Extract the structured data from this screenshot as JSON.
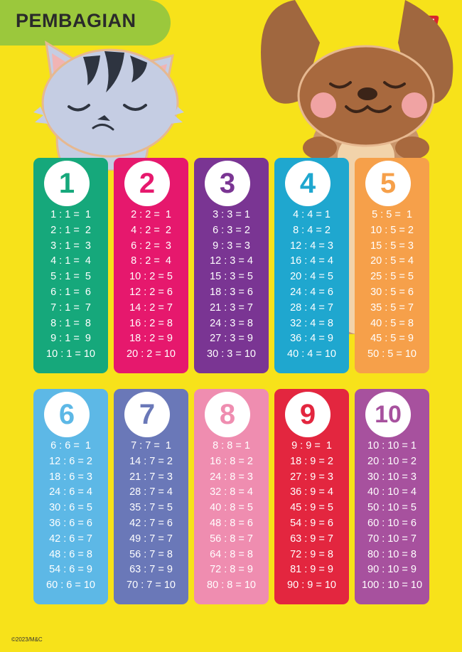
{
  "header": {
    "title": "PEMBAGIAN",
    "logo_text": "m&c!"
  },
  "footer": {
    "copyright": "©2023/M&C"
  },
  "colors": {
    "background": "#f7e21a",
    "title_badge": "#9bc83c",
    "logo": "#d8262e"
  },
  "illustrations": {
    "left": "cat-icon",
    "right": "dog-icon"
  },
  "cards": [
    {
      "divisor": "1",
      "color": "#16a87b",
      "rows": [
        "1 : 1 =  1",
        "2 : 1 =  2",
        "3 : 1 =  3",
        "4 : 1 =  4",
        "5 : 1 =  5",
        "6 : 1 =  6",
        "7 : 1 =  7",
        "8 : 1 =  8",
        "9 : 1 =  9",
        "10 : 1 = 10"
      ]
    },
    {
      "divisor": "2",
      "color": "#e6186d",
      "rows": [
        "2 : 2 =  1",
        "4 : 2 =  2",
        "6 : 2 =  3",
        "8 : 2 =  4",
        "10 : 2 = 5",
        "12 : 2 = 6",
        "14 : 2 = 7",
        "16 : 2 = 8",
        "18 : 2 = 9",
        "20 : 2 = 10"
      ]
    },
    {
      "divisor": "3",
      "color": "#7a3593",
      "rows": [
        "3 : 3 = 1",
        "6 : 3 = 2",
        "9 : 3 = 3",
        "12 : 3 = 4",
        "15 : 3 = 5",
        "18 : 3 = 6",
        "21 : 3 = 7",
        "24 : 3 = 8",
        "27 : 3 = 9",
        "30 : 3 = 10"
      ]
    },
    {
      "divisor": "4",
      "color": "#1fa7cf",
      "rows": [
        "4 : 4 = 1",
        "8 : 4 = 2",
        "12 : 4 = 3",
        "16 : 4 = 4",
        "20 : 4 = 5",
        "24 : 4 = 6",
        "28 : 4 = 7",
        "32 : 4 = 8",
        "36 : 4 = 9",
        "40 : 4 = 10"
      ]
    },
    {
      "divisor": "5",
      "color": "#f6a04a",
      "rows": [
        "5 : 5 =  1",
        "10 : 5 = 2",
        "15 : 5 = 3",
        "20 : 5 = 4",
        "25 : 5 = 5",
        "30 : 5 = 6",
        "35 : 5 = 7",
        "40 : 5 = 8",
        "45 : 5 = 9",
        "50 : 5 = 10"
      ]
    },
    {
      "divisor": "6",
      "color": "#5db8e6",
      "rows": [
        "6 : 6 =  1",
        "12 : 6 = 2",
        "18 : 6 = 3",
        "24 : 6 = 4",
        "30 : 6 = 5",
        "36 : 6 = 6",
        "42 : 6 = 7",
        "48 : 6 = 8",
        "54 : 6 = 9",
        "60 : 6 = 10"
      ]
    },
    {
      "divisor": "7",
      "color": "#6a78b8",
      "rows": [
        "7 : 7 =  1",
        "14 : 7 = 2",
        "21 : 7 = 3",
        "28 : 7 = 4",
        "35 : 7 = 5",
        "42 : 7 = 6",
        "49 : 7 = 7",
        "56 : 7 = 8",
        "63 : 7 = 9",
        "70 : 7 = 10"
      ]
    },
    {
      "divisor": "8",
      "color": "#ef8db0",
      "rows": [
        "8 : 8 = 1",
        "16 : 8 = 2",
        "24 : 8 = 3",
        "32 : 8 = 4",
        "40 : 8 = 5",
        "48 : 8 = 6",
        "56 : 8 = 7",
        "64 : 8 = 8",
        "72 : 8 = 9",
        "80 : 8 = 10"
      ]
    },
    {
      "divisor": "9",
      "color": "#e3263f",
      "rows": [
        "9 : 9 =  1",
        "18 : 9 = 2",
        "27 : 9 = 3",
        "36 : 9 = 4",
        "45 : 9 = 5",
        "54 : 9 = 6",
        "63 : 9 = 7",
        "72 : 9 = 8",
        "81 : 9 = 9",
        "90 : 9 = 10"
      ]
    },
    {
      "divisor": "10",
      "color": "#a7519e",
      "rows": [
        "10 : 10 = 1",
        "20 : 10 = 2",
        "30 : 10 = 3",
        "40 : 10 = 4",
        "50 : 10 = 5",
        "60 : 10 = 6",
        "70 : 10 = 7",
        "80 : 10 = 8",
        "90 : 10 = 9",
        "100 : 10 = 10"
      ]
    }
  ]
}
